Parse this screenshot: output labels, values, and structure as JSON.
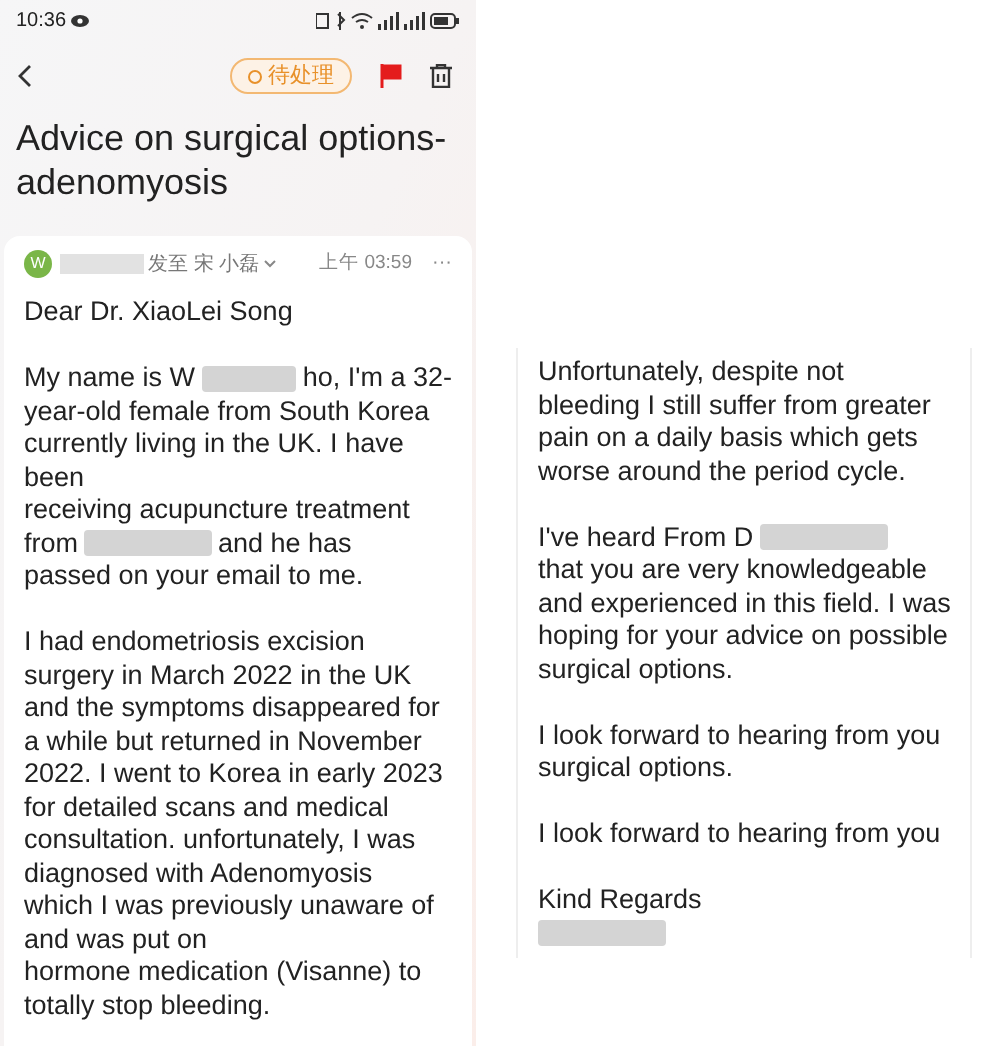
{
  "status_bar": {
    "time": "10:36"
  },
  "toolbar": {
    "status_pill": "待处理",
    "flagged": true
  },
  "email": {
    "subject": "Advice on surgical options-adenomyosis",
    "avatar": "W",
    "recipient": "发至 宋 小磊",
    "time": "上午 03:59",
    "more": "···",
    "body_left": [
      [
        [
          {
            "kind": "text",
            "text": "Dear Dr. XiaoLei Song"
          }
        ]
      ],
      [
        [
          {
            "kind": "text",
            "text": "My name is W"
          },
          {
            "kind": "redacted"
          },
          {
            "kind": "text",
            "text": "ho, I'm a 32-"
          }
        ],
        [
          {
            "kind": "text",
            "text": "year-old female from South Korea"
          }
        ],
        [
          {
            "kind": "text",
            "text": "currently living in the UK. I have"
          }
        ],
        [
          {
            "kind": "text",
            "text": "been"
          }
        ],
        [
          {
            "kind": "text",
            "text": "receiving acupuncture treatment"
          }
        ],
        [
          {
            "kind": "text",
            "text": "from"
          },
          {
            "kind": "redacted"
          },
          {
            "kind": "text",
            "text": "and he has"
          }
        ],
        [
          {
            "kind": "text",
            "text": "passed on your email to me."
          }
        ]
      ],
      [
        [
          {
            "kind": "text",
            "text": "I had endometriosis excision"
          }
        ],
        [
          {
            "kind": "text",
            "text": "surgery in March 2022 in the UK"
          }
        ],
        [
          {
            "kind": "text",
            "text": "and the symptoms disappeared for"
          }
        ],
        [
          {
            "kind": "text",
            "text": "a while but returned in November"
          }
        ],
        [
          {
            "kind": "text",
            "text": "2022. I went to Korea in early 2023"
          }
        ],
        [
          {
            "kind": "text",
            "text": "for detailed scans and medical"
          }
        ],
        [
          {
            "kind": "text",
            "text": "consultation. unfortunately, I was"
          }
        ],
        [
          {
            "kind": "text",
            "text": "diagnosed with Adenomyosis"
          }
        ],
        [
          {
            "kind": "text",
            "text": "which I was previously unaware of"
          }
        ],
        [
          {
            "kind": "text",
            "text": "and was put on"
          }
        ],
        [
          {
            "kind": "text",
            "text": "hormone medication (Visanne) to"
          }
        ],
        [
          {
            "kind": "text",
            "text": "totally stop bleeding."
          }
        ]
      ]
    ],
    "body_right": [
      [
        [
          {
            "kind": "text",
            "text": "Unfortunately, despite not"
          }
        ],
        [
          {
            "kind": "text",
            "text": "bleeding I still suffer from greater"
          }
        ],
        [
          {
            "kind": "text",
            "text": "pain on a daily basis which gets"
          }
        ],
        [
          {
            "kind": "text",
            "text": "worse around the period cycle."
          }
        ]
      ],
      [
        [
          {
            "kind": "text",
            "text": "I've heard From D"
          },
          {
            "kind": "redacted"
          }
        ],
        [
          {
            "kind": "text",
            "text": "that you are very knowledgeable"
          }
        ],
        [
          {
            "kind": "text",
            "text": "and experienced in this field. I was"
          }
        ],
        [
          {
            "kind": "text",
            "text": "hoping for your advice on possible"
          }
        ],
        [
          {
            "kind": "text",
            "text": "surgical options."
          }
        ]
      ],
      [
        [
          {
            "kind": "text",
            "text": "I look forward to hearing from you"
          }
        ],
        [
          {
            "kind": "text",
            "text": "surgical options."
          }
        ]
      ],
      [
        [
          {
            "kind": "text",
            "text": "I look forward to hearing from you"
          }
        ]
      ],
      [
        [
          {
            "kind": "text",
            "text": "Kind Regards"
          }
        ],
        [
          {
            "kind": "redacted"
          }
        ]
      ]
    ]
  }
}
